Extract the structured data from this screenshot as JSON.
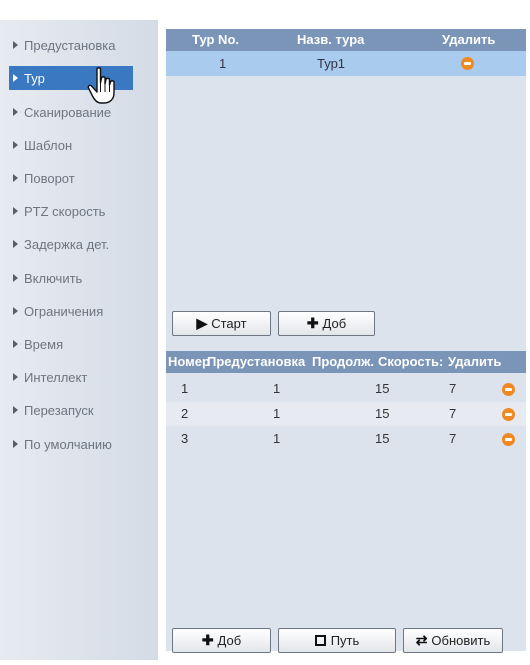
{
  "sidebar": {
    "items": [
      {
        "label": "Предустановка",
        "active": false
      },
      {
        "label": "Тур",
        "active": true
      },
      {
        "label": "Сканирование",
        "active": false
      },
      {
        "label": "Шаблон",
        "active": false
      },
      {
        "label": "Поворот",
        "active": false
      },
      {
        "label": "PTZ скорость",
        "active": false
      },
      {
        "label": "Задержка дет.",
        "active": false
      },
      {
        "label": "Включить",
        "active": false
      },
      {
        "label": "Ограничения",
        "active": false
      },
      {
        "label": "Время",
        "active": false
      },
      {
        "label": "Интеллект",
        "active": false
      },
      {
        "label": "Перезапуск",
        "active": false
      },
      {
        "label": "По умолчанию",
        "active": false
      }
    ]
  },
  "tour_table": {
    "headers": [
      "Тур No.",
      "Назв. тура",
      "Удалить"
    ],
    "rows": [
      {
        "no": "1",
        "name": "Тур1",
        "delete_icon": "minus-circle-icon"
      }
    ]
  },
  "tour_buttons": {
    "start_label": "Старт",
    "start_icon": "play-icon",
    "add_label": "Доб",
    "add_icon": "plus-icon"
  },
  "preset_table": {
    "headers": [
      "Номер",
      "Предустановка",
      "Продолж.",
      "Скорость:",
      "Удалить"
    ],
    "rows": [
      {
        "num": "1",
        "preset": "1",
        "duration": "15",
        "speed": "7"
      },
      {
        "num": "2",
        "preset": "1",
        "duration": "15",
        "speed": "7"
      },
      {
        "num": "3",
        "preset": "1",
        "duration": "15",
        "speed": "7"
      }
    ]
  },
  "bottom_buttons": {
    "add_label": "Доб",
    "add_icon": "plus-icon",
    "path_label": "Путь",
    "path_icon": "save-icon",
    "refresh_label": "Обновить",
    "refresh_icon": "refresh-icon"
  },
  "colors": {
    "accent": "#3a78c2",
    "header": "#7a95b8",
    "selected_row": "#a9cbee",
    "delete": "#ef8a22"
  }
}
